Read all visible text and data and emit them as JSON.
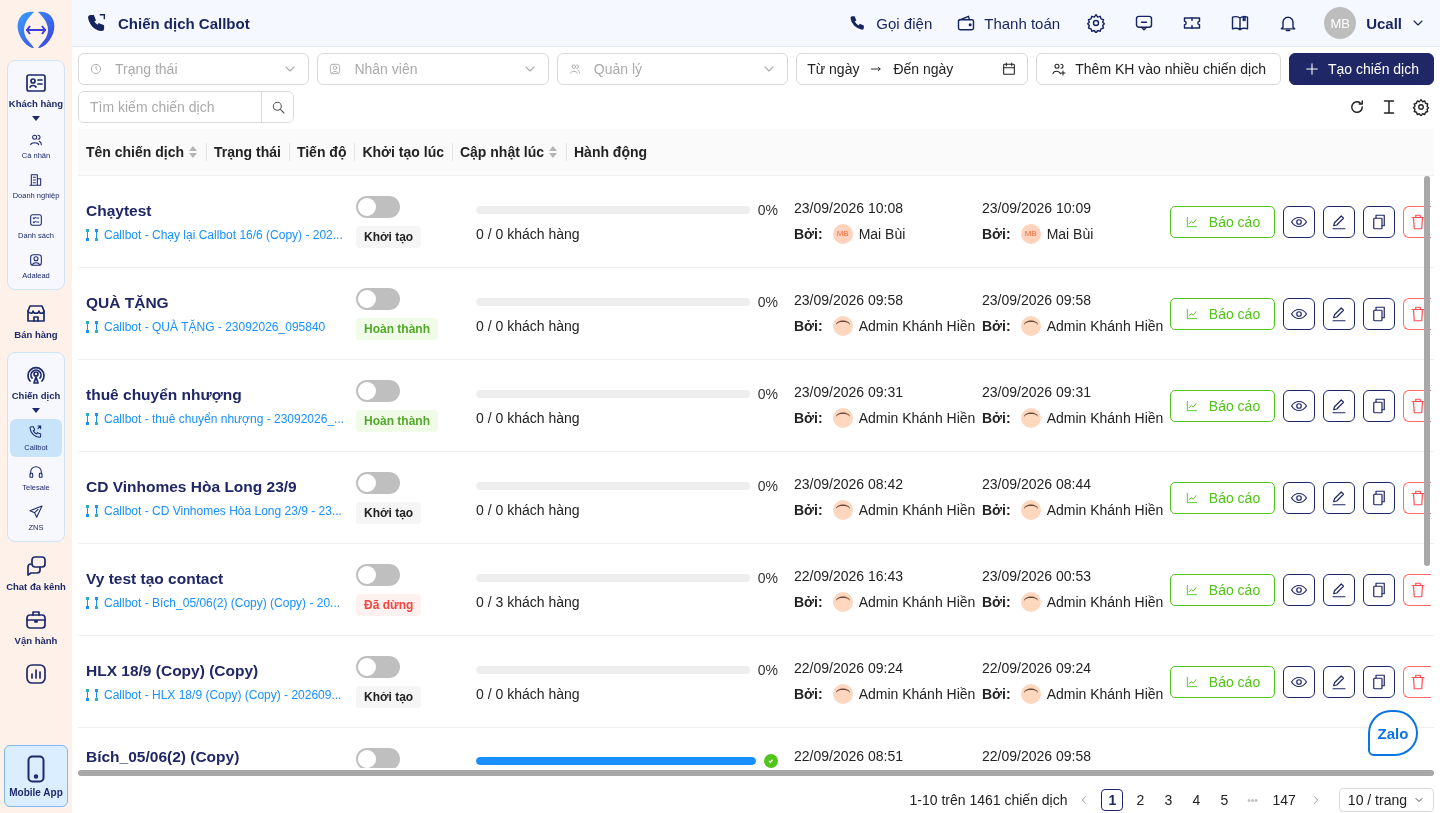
{
  "sidebar": {
    "nav": [
      {
        "label": "Khách hàng",
        "expanded": true,
        "children": [
          {
            "label": "Cá nhân",
            "selected": false
          },
          {
            "label": "Doanh nghiệp",
            "selected": false
          },
          {
            "label": "Danh sách",
            "selected": false
          },
          {
            "label": "Adalead",
            "selected": false
          }
        ]
      },
      {
        "label": "Bán hàng"
      },
      {
        "label": "Chiến dịch",
        "expanded": true,
        "children": [
          {
            "label": "Callbot",
            "selected": true
          },
          {
            "label": "Telesale",
            "selected": false
          },
          {
            "label": "ZNS",
            "selected": false
          }
        ]
      },
      {
        "label": "Chat đa kênh"
      },
      {
        "label": "Vận hành"
      }
    ],
    "mobile_app": "Mobile App"
  },
  "header": {
    "title": "Chiến dịch Callbot",
    "links": [
      "Gọi điện",
      "Thanh toán"
    ],
    "avatar": "MB",
    "user": "Ucall"
  },
  "filters": {
    "selects": [
      "Trạng thái",
      "Nhân viên",
      "Quản lý"
    ],
    "date_from": "Từ ngày",
    "date_to": "Đến ngày",
    "add_button": "Thêm KH vào nhiều chiến dịch",
    "create_button": "Tạo chiến dịch",
    "search": {
      "placeholder": "Tìm kiếm chiến dịch"
    }
  },
  "table": {
    "columns": [
      {
        "label": "Tên chiến dịch",
        "sortable": true
      },
      {
        "label": "Trạng thái",
        "sortable": false
      },
      {
        "label": "Tiến độ",
        "sortable": false
      },
      {
        "label": "Khởi tạo lúc",
        "sortable": false
      },
      {
        "label": "Cập nhật lúc",
        "sortable": true
      },
      {
        "label": "Hành động",
        "sortable": false
      }
    ],
    "rows": [
      {
        "name": "Chạytest",
        "source": "Callbot - Chạy lại Callbot 16/6 (Copy) - 202...",
        "on": false,
        "status": {
          "label": "Khởi tạo",
          "kind": "init"
        },
        "level": 0,
        "percent": "0%",
        "customers": "0 / 0 khách hàng",
        "created": "23/09/2026 10:08",
        "created_by": {
          "label": "Bởi:",
          "name": "Mai Bùi",
          "initials": "MB"
        },
        "updated": "23/09/2026 10:09",
        "updated_by": {
          "label": "Bởi:",
          "name": "Mai Bùi",
          "initials": "MB"
        },
        "report": "Báo cáo"
      },
      {
        "name": "QUÀ TẶNG",
        "source": "Callbot - QUÀ TẶNG - 23092026_095840",
        "on": false,
        "status": {
          "label": "Hoàn thành",
          "kind": "done"
        },
        "level": 0,
        "percent": "0%",
        "customers": "0 / 0 khách hàng",
        "created": "23/09/2026 09:58",
        "created_by": {
          "label": "Bởi:",
          "name": "Admin Khánh Hiền"
        },
        "updated": "23/09/2026 09:58",
        "updated_by": {
          "label": "Bởi:",
          "name": "Admin Khánh Hiền"
        },
        "report": "Báo cáo"
      },
      {
        "name": "thuê chuyển nhượng",
        "source": "Callbot - thuê chuyển nhượng - 23092026_...",
        "on": false,
        "status": {
          "label": "Hoàn thành",
          "kind": "done"
        },
        "level": 0,
        "percent": "0%",
        "customers": "0 / 0 khách hàng",
        "created": "23/09/2026 09:31",
        "created_by": {
          "label": "Bởi:",
          "name": "Admin Khánh Hiền"
        },
        "updated": "23/09/2026 09:31",
        "updated_by": {
          "label": "Bởi:",
          "name": "Admin Khánh Hiền"
        },
        "report": "Báo cáo"
      },
      {
        "name": "CD Vinhomes Hòa Long 23/9",
        "source": "Callbot - CD Vinhomes Hòa Long 23/9 - 23...",
        "on": false,
        "status": {
          "label": "Khởi tạo",
          "kind": "init"
        },
        "level": 0,
        "percent": "0%",
        "customers": "0 / 0 khách hàng",
        "created": "23/09/2026 08:42",
        "created_by": {
          "label": "Bởi:",
          "name": "Admin Khánh Hiền"
        },
        "updated": "23/09/2026 08:44",
        "updated_by": {
          "label": "Bởi:",
          "name": "Admin Khánh Hiền"
        },
        "report": "Báo cáo"
      },
      {
        "name": "Vy test tạo contact",
        "source": "Callbot - Bích_05/06(2) (Copy) (Copy) - 20...",
        "on": false,
        "status": {
          "label": "Đã dừng",
          "kind": "stopped"
        },
        "level": 0,
        "percent": "0%",
        "customers": "0 / 3 khách hàng",
        "created": "22/09/2026 16:43",
        "created_by": {
          "label": "Bởi:",
          "name": "Admin Khánh Hiền"
        },
        "updated": "23/09/2026 00:53",
        "updated_by": {
          "label": "Bởi:",
          "name": "Admin Khánh Hiền"
        },
        "report": "Báo cáo"
      },
      {
        "name": "HLX 18/9 (Copy) (Copy)",
        "source": "Callbot - HLX 18/9 (Copy) (Copy) - 202609...",
        "on": false,
        "status": {
          "label": "Khởi tạo",
          "kind": "init"
        },
        "level": 0,
        "percent": "0%",
        "customers": "0 / 0 khách hàng",
        "created": "22/09/2026 09:24",
        "created_by": {
          "label": "Bởi:",
          "name": "Admin Khánh Hiền"
        },
        "updated": "22/09/2026 09:24",
        "updated_by": {
          "label": "Bởi:",
          "name": "Admin Khánh Hiền"
        },
        "report": "Báo cáo"
      },
      {
        "name": "Bích_05/06(2) (Copy)",
        "on": false,
        "level": 1,
        "complete": true,
        "created": "22/09/2026 08:51",
        "updated": "22/09/2026 09:58"
      }
    ]
  },
  "pagination": {
    "summary": "1-10 trên 1461 chiến dịch",
    "pages": [
      {
        "label": "1",
        "selected": true
      },
      {
        "label": "2",
        "selected": false
      },
      {
        "label": "3",
        "selected": false
      },
      {
        "label": "4",
        "selected": false
      },
      {
        "label": "5",
        "selected": false
      },
      {
        "label": "•••",
        "selected": false
      },
      {
        "label": "147",
        "selected": false
      }
    ],
    "page_size": "10 / trang"
  },
  "zalo": "Zalo"
}
